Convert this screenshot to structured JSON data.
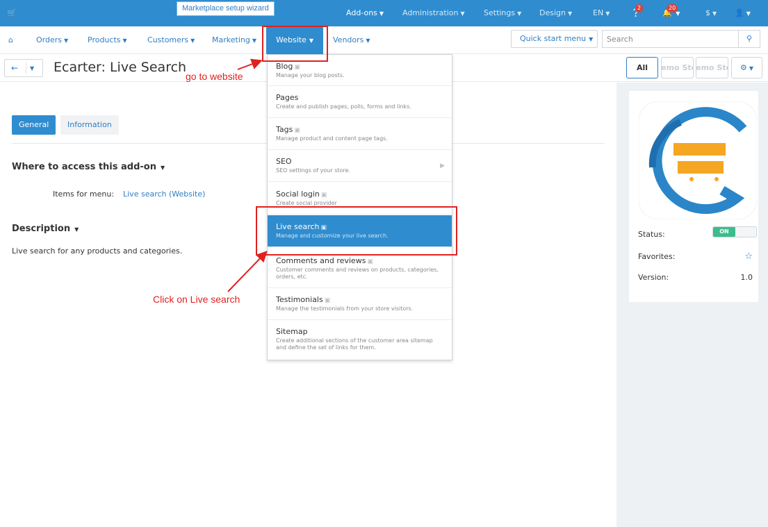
{
  "topbar": {
    "wizard_label": "Marketplace setup wizard",
    "items": [
      {
        "label": "Add-ons"
      },
      {
        "label": "Administration"
      },
      {
        "label": "Settings"
      },
      {
        "label": "Design"
      },
      {
        "label": "EN"
      }
    ],
    "help_badge": "2",
    "notifications_badge": "20",
    "currency": "$"
  },
  "mainnav": {
    "orders": "Orders",
    "products": "Products",
    "customers": "Customers",
    "marketing": "Marketing",
    "website": "Website",
    "vendors": "Vendors",
    "quick_start": "Quick start menu",
    "search_placeholder": "Search"
  },
  "titlebar": {
    "title": "Ecarter: Live Search",
    "store_all": "All",
    "store_1": "Demo Store",
    "store_2": "Demo Store"
  },
  "tabs": {
    "general": "General",
    "information": "Information"
  },
  "access_section": {
    "heading": "Where to access this add-on",
    "items_label": "Items for menu:",
    "items_link": "Live search (Website)"
  },
  "description_section": {
    "heading": "Description",
    "text": "Live search for any products and categories."
  },
  "sidebar": {
    "status_label": "Status:",
    "status_value": "ON",
    "favorites_label": "Favorites:",
    "version_label": "Version:",
    "version_value": "1.0"
  },
  "dropdown": [
    {
      "title": "Blog",
      "desc": "Manage your blog posts."
    },
    {
      "title": "Pages",
      "desc": "Create and publish pages, polls, forms and links."
    },
    {
      "title": "Tags",
      "desc": "Manage product and content page tags."
    },
    {
      "title": "SEO",
      "desc": "SEO settings of your store."
    },
    {
      "title": "Social login",
      "desc": "Create social provider"
    },
    {
      "title": "Live search",
      "desc": "Manage and customize your live search."
    },
    {
      "title": "Comments and reviews",
      "desc": "Customer comments and reviews on products, categories, orders, etc."
    },
    {
      "title": "Testimonials",
      "desc": "Manage the testimonials from your store visitors."
    },
    {
      "title": "Sitemap",
      "desc": "Create additional sections of the customer area sitemap and define the set of links for them."
    }
  ],
  "annotations": {
    "go_to_website": "go to website",
    "click_live_search": "Click on Live search"
  },
  "colors": {
    "primary": "#2f8ccf",
    "link": "#2f7ec4",
    "annotation": "#e02020",
    "status_on": "#3cbd8b"
  }
}
